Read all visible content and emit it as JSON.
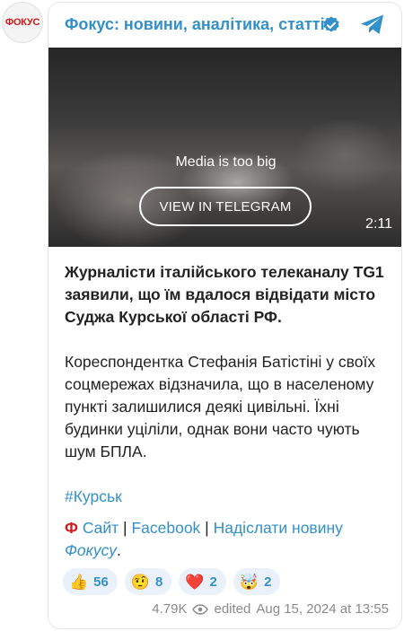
{
  "channel": {
    "avatar_text": "ФОКУС",
    "title": "Фокус: новини, аналітика, статті",
    "verified_icon": "verified-badge-icon",
    "telegram_icon": "telegram-plane-icon"
  },
  "media": {
    "note": "Media is too big",
    "button_label": "VIEW IN TELEGRAM",
    "duration": "2:11"
  },
  "post": {
    "headline": "Журналісти італійського телеканалу TG1 заявили, що їм вдалося відвідати місто Суджа Курської області РФ.",
    "body": "Кореспондентка Стефанія Батістіні у своїх соцмережах відзначила, що в населеному пункті залишилися деякі цивільні. Їхні будинки уціліли, однак вони часто чують шум БПЛА.",
    "hashtag": "#Курськ",
    "links": {
      "logo": "Ф",
      "site": "Сайт",
      "sep1": " | ",
      "facebook": "Facebook",
      "sep2": " | ",
      "send_news": "Надіслати новину",
      "focus": "Фокусу",
      "period": "."
    }
  },
  "reactions": [
    {
      "emoji": "👍",
      "icon": "thumbs-up-icon",
      "count": "56"
    },
    {
      "emoji": "🤨",
      "icon": "raised-eyebrow-face-icon",
      "count": "8"
    },
    {
      "emoji": "❤️",
      "icon": "heart-icon",
      "count": "2"
    },
    {
      "emoji": "🤯",
      "icon": "exploding-head-icon",
      "count": "2"
    }
  ],
  "footer": {
    "views": "4.79K",
    "eye_icon": "eye-icon",
    "edited_label": "edited",
    "timestamp": "Aug 15, 2024 at 13:55"
  },
  "colors": {
    "accent": "#3390c9",
    "brand_red": "#d31a1a",
    "reaction_bg": "#eaf1fa"
  }
}
